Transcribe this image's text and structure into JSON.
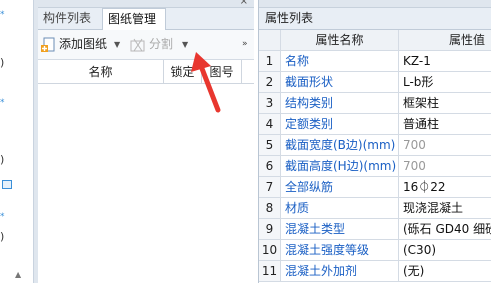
{
  "left_strip": {
    "marks": [
      "*",
      "*",
      "*"
    ],
    "parens": [
      ")",
      ")",
      ")"
    ]
  },
  "mid_panel": {
    "close_glyph": "×",
    "tabs": [
      {
        "label": "构件列表",
        "active": false
      },
      {
        "label": "图纸管理",
        "active": true
      }
    ],
    "toolbar": {
      "add_label": "添加图纸",
      "add_caret": "▼",
      "split_label": "分割",
      "split_caret": "▼",
      "more_glyph": "»"
    },
    "columns": [
      "名称",
      "锁定",
      "图号"
    ]
  },
  "property_panel": {
    "title": "属性列表",
    "headers": {
      "name": "属性名称",
      "value": "属性值"
    },
    "rows": [
      {
        "num": "1",
        "name": "名称",
        "value": "KZ-1",
        "gray": false
      },
      {
        "num": "2",
        "name": "截面形状",
        "value": "L-b形",
        "gray": false
      },
      {
        "num": "3",
        "name": "结构类别",
        "value": "框架柱",
        "gray": false
      },
      {
        "num": "4",
        "name": "定额类别",
        "value": "普通柱",
        "gray": false
      },
      {
        "num": "5",
        "name": "截面宽度(B边)(mm)",
        "value": "700",
        "gray": true
      },
      {
        "num": "6",
        "name": "截面高度(H边)(mm)",
        "value": "700",
        "gray": true
      },
      {
        "num": "7",
        "name": "全部纵筋",
        "value": "16⏀22",
        "gray": false
      },
      {
        "num": "8",
        "name": "材质",
        "value": "现浇混凝土",
        "gray": false
      },
      {
        "num": "9",
        "name": "混凝土类型",
        "value": "(砾石 GD40 细砂",
        "gray": false
      },
      {
        "num": "10",
        "name": "混凝土强度等级",
        "value": "(C30)",
        "gray": false
      },
      {
        "num": "11",
        "name": "混凝土外加剂",
        "value": "(无)",
        "gray": false
      }
    ]
  },
  "colors": {
    "accent_blue": "#1a5fc4",
    "annotation_arrow": "#e8372f",
    "panel_bg": "#e8eef5"
  },
  "icons": [
    "add-drawing-icon",
    "split-icon",
    "close-icon",
    "more-icon",
    "red-annotation-arrow"
  ]
}
